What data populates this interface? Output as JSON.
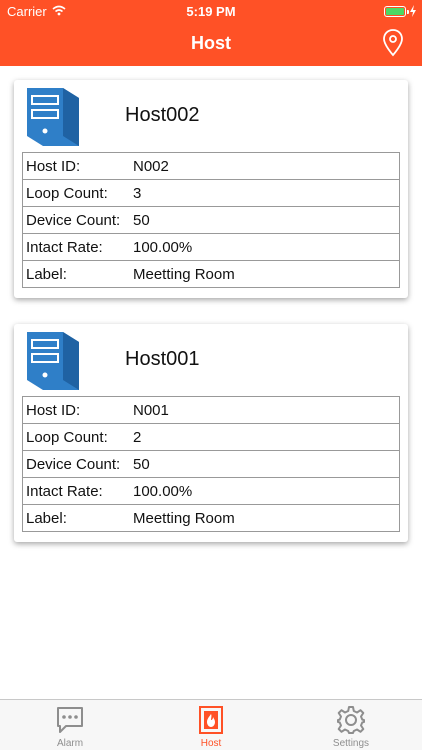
{
  "status_bar": {
    "carrier": "Carrier",
    "time": "5:19 PM",
    "battery_icon": "battery-full-icon",
    "charging_icon": "charging-bolt-icon"
  },
  "nav": {
    "title": "Host",
    "right_icon": "location-pin-icon"
  },
  "colors": {
    "accent": "#ff5126",
    "host_icon": "#2f7fc8",
    "tab_inactive": "#8e8e8e"
  },
  "hosts": [
    {
      "name": "Host002",
      "icon": "server-tower-icon",
      "rows": [
        {
          "label": "Host ID:",
          "value": "N002"
        },
        {
          "label": "Loop Count:",
          "value": "3"
        },
        {
          "label": "Device Count:",
          "value": "50"
        },
        {
          "label": "Intact Rate:",
          "value": "100.00%"
        },
        {
          "label": "Label:",
          "value": "Meetting Room"
        }
      ]
    },
    {
      "name": "Host001",
      "icon": "server-tower-icon",
      "rows": [
        {
          "label": "Host ID:",
          "value": "N001"
        },
        {
          "label": "Loop Count:",
          "value": "2"
        },
        {
          "label": "Device Count:",
          "value": "50"
        },
        {
          "label": "Intact Rate:",
          "value": "100.00%"
        },
        {
          "label": "Label:",
          "value": "Meetting Room"
        }
      ]
    }
  ],
  "tabs": [
    {
      "label": "Alarm",
      "icon": "chat-bubble-icon",
      "selected": false
    },
    {
      "label": "Host",
      "icon": "fire-host-icon",
      "selected": true
    },
    {
      "label": "Settings",
      "icon": "gear-icon",
      "selected": false
    }
  ]
}
